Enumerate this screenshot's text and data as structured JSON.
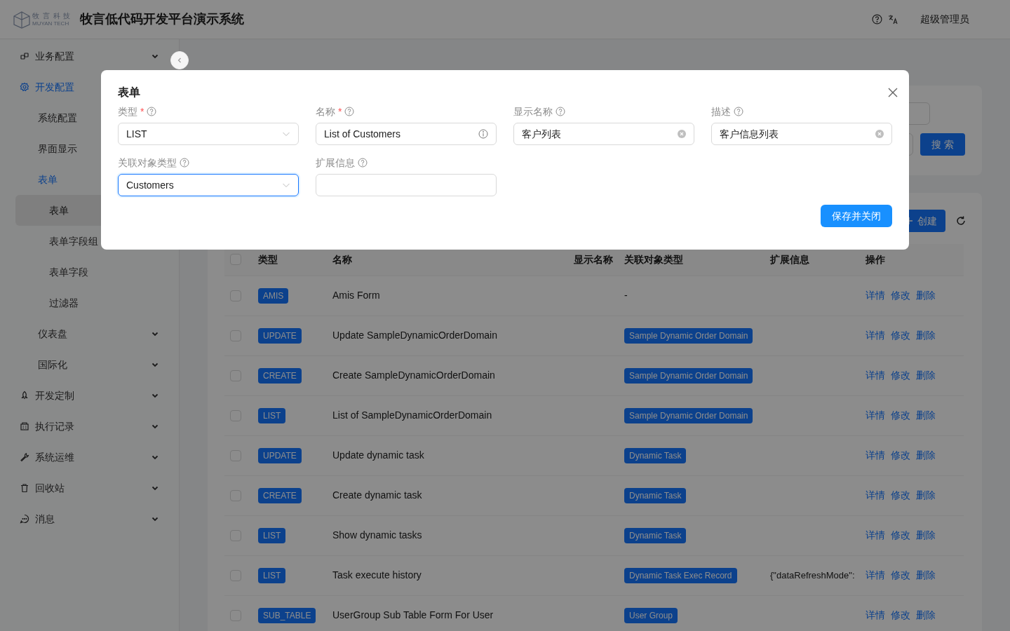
{
  "header": {
    "logo_cn": "牧 言 科 技",
    "logo_en": "MUYAN TECH",
    "title": "牧言低代码开发平台演示系统",
    "user": "超级管理员"
  },
  "sidebar": {
    "items": [
      {
        "label": "业务配置",
        "expanded": false,
        "selected": false
      },
      {
        "label": "开发配置",
        "expanded": true,
        "selected": true,
        "children": [
          {
            "label": "系统配置",
            "selected": false
          },
          {
            "label": "界面显示",
            "selected": false
          },
          {
            "label": "表单",
            "expanded": true,
            "selected": true,
            "children": [
              {
                "label": "表单",
                "selected": true
              },
              {
                "label": "表单字段组",
                "selected": false
              },
              {
                "label": "表单字段",
                "selected": false
              },
              {
                "label": "过滤器",
                "selected": false
              }
            ]
          },
          {
            "label": "仪表盘",
            "expanded": false,
            "selected": false
          },
          {
            "label": "国际化",
            "expanded": false,
            "selected": false
          }
        ]
      },
      {
        "label": "开发定制",
        "expanded": false,
        "selected": false
      },
      {
        "label": "执行记录",
        "expanded": false,
        "selected": false
      },
      {
        "label": "系统运维",
        "expanded": false,
        "selected": false
      },
      {
        "label": "回收站",
        "expanded": false,
        "selected": false
      },
      {
        "label": "消息",
        "expanded": false,
        "selected": false
      }
    ]
  },
  "page": {
    "search_button": "搜 索",
    "create_button": "创建"
  },
  "table": {
    "header_checked": false,
    "columns": [
      "类型",
      "名称",
      "显示名称",
      "关联对象类型",
      "扩展信息",
      "操作"
    ],
    "rows": [
      {
        "checked": false,
        "type": "AMIS",
        "name": "Amis Form",
        "related": {
          "kind": "text",
          "text": "-"
        },
        "actions": [
          "详情",
          "修改",
          "删除"
        ]
      },
      {
        "checked": false,
        "type": "UPDATE",
        "name": "Update SampleDynamicOrderDomain",
        "related": {
          "kind": "tag",
          "text": "Sample Dynamic Order Domain"
        },
        "actions": [
          "详情",
          "修改",
          "删除"
        ]
      },
      {
        "checked": false,
        "type": "CREATE",
        "name": "Create SampleDynamicOrderDomain",
        "related": {
          "kind": "tag",
          "text": "Sample Dynamic Order Domain"
        },
        "actions": [
          "详情",
          "修改",
          "删除"
        ]
      },
      {
        "checked": false,
        "type": "LIST",
        "name": "List of SampleDynamicOrderDomain",
        "related": {
          "kind": "tag",
          "text": "Sample Dynamic Order Domain"
        },
        "actions": [
          "详情",
          "修改",
          "删除"
        ]
      },
      {
        "checked": false,
        "type": "UPDATE",
        "name": "Update dynamic task",
        "related": {
          "kind": "tag",
          "text": "Dynamic Task"
        },
        "actions": [
          "详情",
          "修改",
          "删除"
        ]
      },
      {
        "checked": false,
        "type": "CREATE",
        "name": "Create dynamic task",
        "related": {
          "kind": "tag",
          "text": "Dynamic Task"
        },
        "actions": [
          "详情",
          "修改",
          "删除"
        ]
      },
      {
        "checked": false,
        "type": "LIST",
        "name": "Show dynamic tasks",
        "related": {
          "kind": "tag",
          "text": "Dynamic Task"
        },
        "actions": [
          "详情",
          "修改",
          "删除"
        ]
      },
      {
        "checked": false,
        "type": "LIST",
        "name": "Task execute history",
        "related": {
          "kind": "tag",
          "text": "Dynamic Task Exec Record"
        },
        "ext": "{\"dataRefreshMode\":",
        "actions": [
          "详情",
          "修改",
          "删除"
        ]
      },
      {
        "checked": false,
        "type": "SUB_TABLE",
        "name": "UserGroup Sub Table Form For User",
        "related": {
          "kind": "tag",
          "text": "User Group"
        },
        "actions": [
          "详情",
          "修改",
          "删除"
        ]
      }
    ]
  },
  "dialog": {
    "title": "表单",
    "fields": [
      {
        "label": "类型",
        "required_mark": "*",
        "kind": "select",
        "value": "LIST",
        "focused": false
      },
      {
        "label": "名称",
        "required_mark": "*",
        "kind": "info",
        "value": "List of Customers",
        "focused": false
      },
      {
        "label": "显示名称",
        "kind": "clearable",
        "value": "客户列表",
        "focused": false
      },
      {
        "label": "描述",
        "kind": "clearable",
        "value": "客户信息列表",
        "focused": false
      },
      {
        "label": "关联对象类型",
        "kind": "select",
        "value": "Customers",
        "focused": true
      },
      {
        "label": "扩展信息",
        "kind": "input",
        "focused": false
      }
    ],
    "submit": "保存并关闭"
  }
}
